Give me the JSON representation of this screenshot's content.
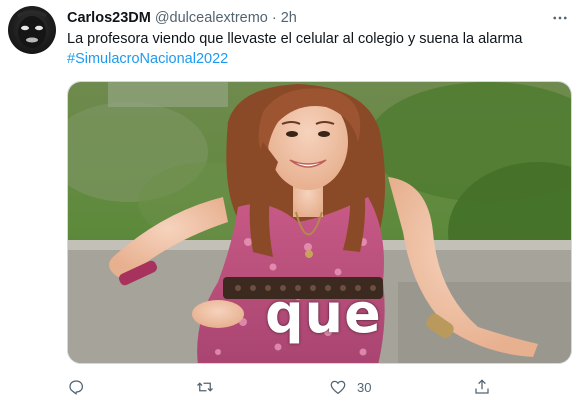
{
  "tweet": {
    "display_name": "Carlos23DM",
    "handle": "@dulcealextremo",
    "separator": "·",
    "time": "2h",
    "text": "La profesora viendo que llevaste el celular al colegio y suena la alarma",
    "hashtag": "#SimulacroNacional2022",
    "media_caption": "que"
  },
  "actions": {
    "reply_count": "",
    "retweet_count": "",
    "like_count": "30"
  },
  "colors": {
    "link": "#1d9bf0",
    "secondary_text": "#536471",
    "primary_text": "#0f1419"
  },
  "icons": [
    "more-icon",
    "reply-icon",
    "retweet-icon",
    "like-icon",
    "share-icon"
  ]
}
